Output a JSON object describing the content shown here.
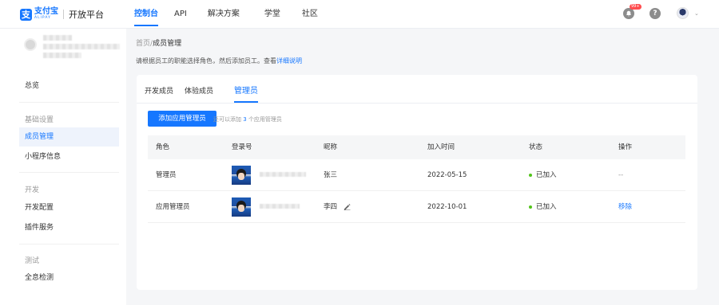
{
  "brand": {
    "mark": "支",
    "name_cn": "支付宝",
    "name_en": "ALIPAY",
    "platform": "开放平台"
  },
  "nav": [
    "控制台",
    "API",
    "解决方案",
    "学堂",
    "社区"
  ],
  "notifications": {
    "badge": "99+"
  },
  "help_glyph": "?",
  "sidebar": {
    "overview": "总览",
    "groups": [
      {
        "title": "基础设置",
        "items": [
          "成员管理",
          "小程序信息"
        ]
      },
      {
        "title": "开发",
        "items": [
          "开发配置",
          "插件服务"
        ]
      },
      {
        "title": "测试",
        "items": [
          "全息检测"
        ]
      }
    ]
  },
  "breadcrumb": {
    "home": "首页",
    "sep": "/",
    "current": "成员管理"
  },
  "info": {
    "text": "请根据员工的职能选择角色，然后添加员工。查看",
    "link": "详细说明"
  },
  "tabs": [
    "开发成员",
    "体验成员",
    "管理员"
  ],
  "add_button": "添加应用管理员",
  "hint": {
    "pre": "还可以添加",
    "count": "3",
    "post": "个应用管理员"
  },
  "table": {
    "headers": [
      "角色",
      "登录号",
      "昵称",
      "加入时间",
      "状态",
      "操作"
    ],
    "rows": [
      {
        "role": "管理员",
        "nickname": "张三",
        "joined": "2022-05-15",
        "status": "已加入",
        "action": "--"
      },
      {
        "role": "应用管理员",
        "nickname": "李四",
        "joined": "2022-10-01",
        "status": "已加入",
        "action": "移除"
      }
    ]
  },
  "colors": {
    "accent": "#1677ff",
    "status_ok": "#52c41a"
  },
  "icons": [
    "bell-icon",
    "help-icon",
    "edit-icon",
    "chevron-down-icon"
  ]
}
